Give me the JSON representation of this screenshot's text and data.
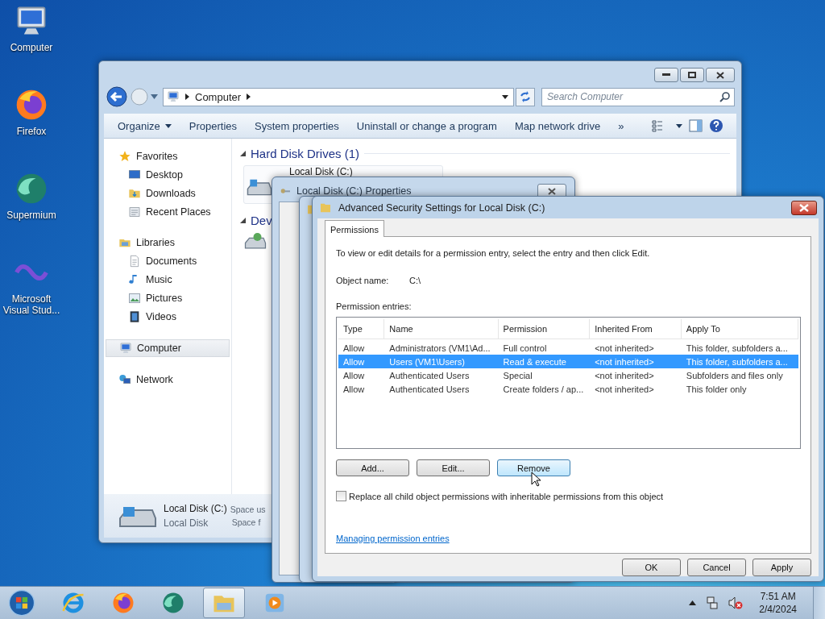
{
  "desktop_icons": [
    {
      "label": "Computer",
      "kind": "computer"
    },
    {
      "label": "Firefox",
      "kind": "firefox"
    },
    {
      "label": "Supermium",
      "kind": "supermium"
    },
    {
      "label": "Microsoft Visual Stud...",
      "kind": "vs"
    }
  ],
  "explorer": {
    "address": "Computer",
    "search": {
      "placeholder": "Search Computer"
    },
    "toolbar": [
      {
        "label": "Organize",
        "kind": "menu"
      },
      {
        "label": "Properties",
        "kind": "button"
      },
      {
        "label": "System properties",
        "kind": "button"
      },
      {
        "label": "Uninstall or change a program",
        "kind": "button"
      },
      {
        "label": "Map network drive",
        "kind": "button"
      },
      {
        "label": "»",
        "kind": "button"
      }
    ],
    "nav": [
      {
        "label": "Favorites",
        "kind": "star",
        "selected": false,
        "children": [
          {
            "label": "Desktop",
            "kind": "desktop",
            "selected": false
          },
          {
            "label": "Downloads",
            "kind": "downloads",
            "selected": false
          },
          {
            "label": "Recent Places",
            "kind": "recent",
            "selected": false
          }
        ]
      },
      {
        "label": "Libraries",
        "kind": "library",
        "selected": false,
        "children": [
          {
            "label": "Documents",
            "kind": "document",
            "selected": false
          },
          {
            "label": "Music",
            "kind": "music",
            "selected": false
          },
          {
            "label": "Pictures",
            "kind": "pictures",
            "selected": false
          },
          {
            "label": "Videos",
            "kind": "videos",
            "selected": false
          }
        ]
      },
      {
        "label": "Computer",
        "kind": "computer",
        "selected": true
      },
      {
        "label": "Network",
        "kind": "network",
        "selected": false
      }
    ],
    "sections": [
      {
        "title": "Hard Disk Drives (1)",
        "drive": "Local Disk (C:)"
      },
      {
        "title": "Dev"
      }
    ],
    "details": {
      "name": "Local Disk (C:)",
      "type": "Local Disk",
      "column_1": "Space us",
      "column_2": "Space f"
    }
  },
  "properties_window": {
    "title": "Local Disk (C:) Properties"
  },
  "dialog": {
    "title": "Advanced Security Settings for Local Disk (C:)",
    "tabs": [
      {
        "label": "Permissions",
        "selected": true
      }
    ],
    "instruction": "To view or edit details for a permission entry, select the entry and then click Edit.",
    "object_label": "Object name:",
    "object_value": "C:\\",
    "entries_label": "Permission entries:",
    "columns": [
      "Type",
      "Name",
      "Permission",
      "Inherited From",
      "Apply To"
    ],
    "rows": [
      {
        "cells": [
          "Allow",
          "Administrators (VM1\\Ad...",
          "Full control",
          "<not inherited>",
          "This folder, subfolders a..."
        ],
        "selected": false
      },
      {
        "cells": [
          "Allow",
          "Users (VM1\\Users)",
          "Read & execute",
          "<not inherited>",
          "This folder, subfolders a..."
        ],
        "selected": true
      },
      {
        "cells": [
          "Allow",
          "Authenticated Users",
          "Special",
          "<not inherited>",
          "Subfolders and files only"
        ],
        "selected": false
      },
      {
        "cells": [
          "Allow",
          "Authenticated Users",
          "Create folders / ap...",
          "<not inherited>",
          "This folder only"
        ],
        "selected": false
      }
    ],
    "row_buttons": [
      {
        "label": "Add...",
        "hovered": false
      },
      {
        "label": "Edit...",
        "hovered": false
      },
      {
        "label": "Remove",
        "hovered": true
      }
    ],
    "replace_checkbox": {
      "label": "Replace all child object permissions with inheritable permissions from this object",
      "checked": false
    },
    "link": "Managing permission entries",
    "buttons": [
      "OK",
      "Cancel",
      "Apply"
    ]
  },
  "taskbar": {
    "items": [
      {
        "kind": "ie",
        "selected": false
      },
      {
        "kind": "firefox",
        "selected": false
      },
      {
        "kind": "supermium",
        "selected": false
      },
      {
        "kind": "explorer",
        "selected": true
      },
      {
        "kind": "media",
        "selected": false
      }
    ],
    "time": "7:51 AM",
    "date": "2/4/2024"
  }
}
